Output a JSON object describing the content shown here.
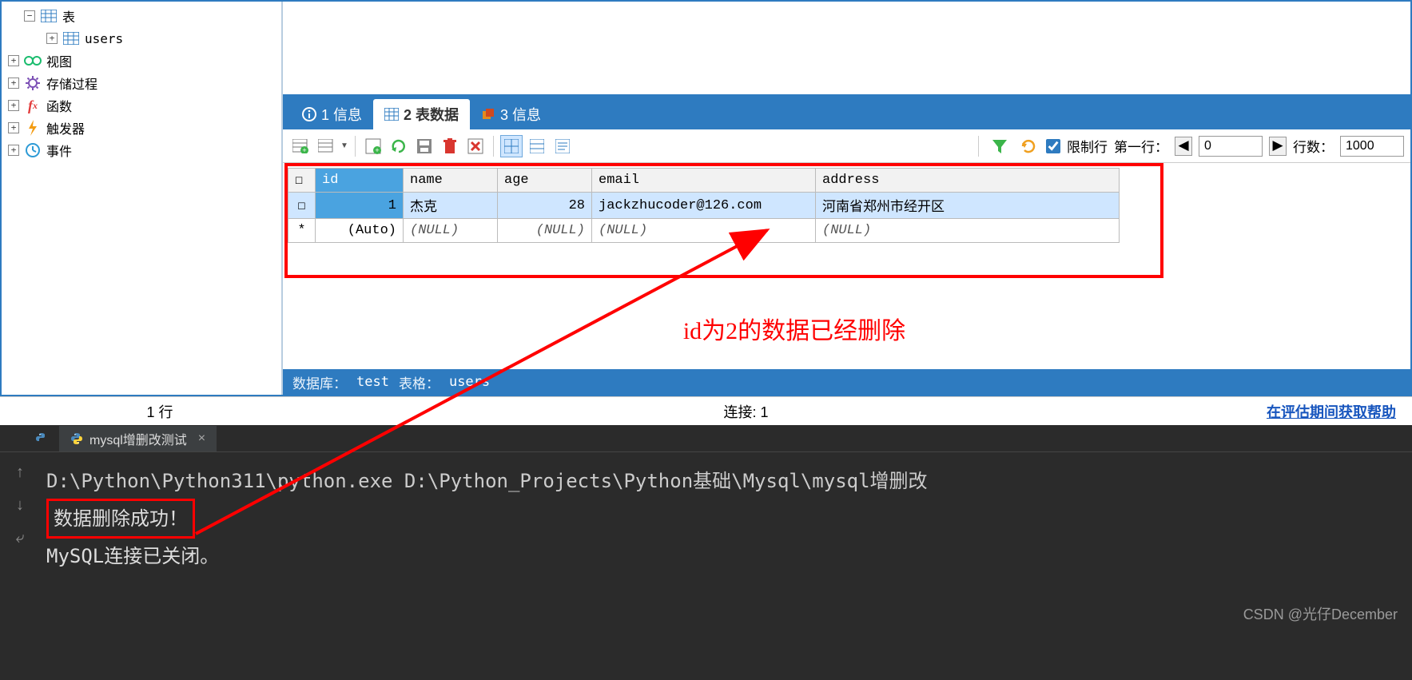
{
  "tree": {
    "tables_label": "表",
    "users_label": "users",
    "views_label": "视图",
    "procs_label": "存储过程",
    "funcs_label": "函数",
    "triggers_label": "触发器",
    "events_label": "事件"
  },
  "tabs": {
    "t1": "1 信息",
    "t2": "2 表数据",
    "t3": "3 信息"
  },
  "toolbar": {
    "limit_rows": "限制行",
    "first_row_label": "第一行：",
    "first_row_value": "0",
    "row_count_label": "行数：",
    "row_count_value": "1000"
  },
  "columns": {
    "id": "id",
    "name": "name",
    "age": "age",
    "email": "email",
    "address": "address"
  },
  "rows": [
    {
      "chk": "☐",
      "id": "1",
      "name": "杰克",
      "age": "28",
      "email": "jackzhucoder@126.com",
      "address": "河南省郑州市经开区"
    }
  ],
  "newrow": {
    "marker": "*",
    "id": "(Auto)",
    "name": "(NULL)",
    "age": "(NULL)",
    "email": "(NULL)",
    "address": "(NULL)"
  },
  "annotation": "id为2的数据已经删除",
  "dbfoot": {
    "db_label": "数据库：",
    "db_value": "test",
    "tbl_label": "表格：",
    "tbl_value": "users"
  },
  "status": {
    "rows": "1 行",
    "conn": "连接: 1",
    "help": "在评估期间获取帮助"
  },
  "console": {
    "tab_prev": "",
    "tab": "mysql增删改测试",
    "line1": "D:\\Python\\Python311\\python.exe D:\\Python_Projects\\Python基础\\Mysql\\mysql增删改",
    "line2": "数据删除成功！",
    "line3": "MySQL连接已关闭。"
  },
  "watermark": "CSDN @光仔December"
}
